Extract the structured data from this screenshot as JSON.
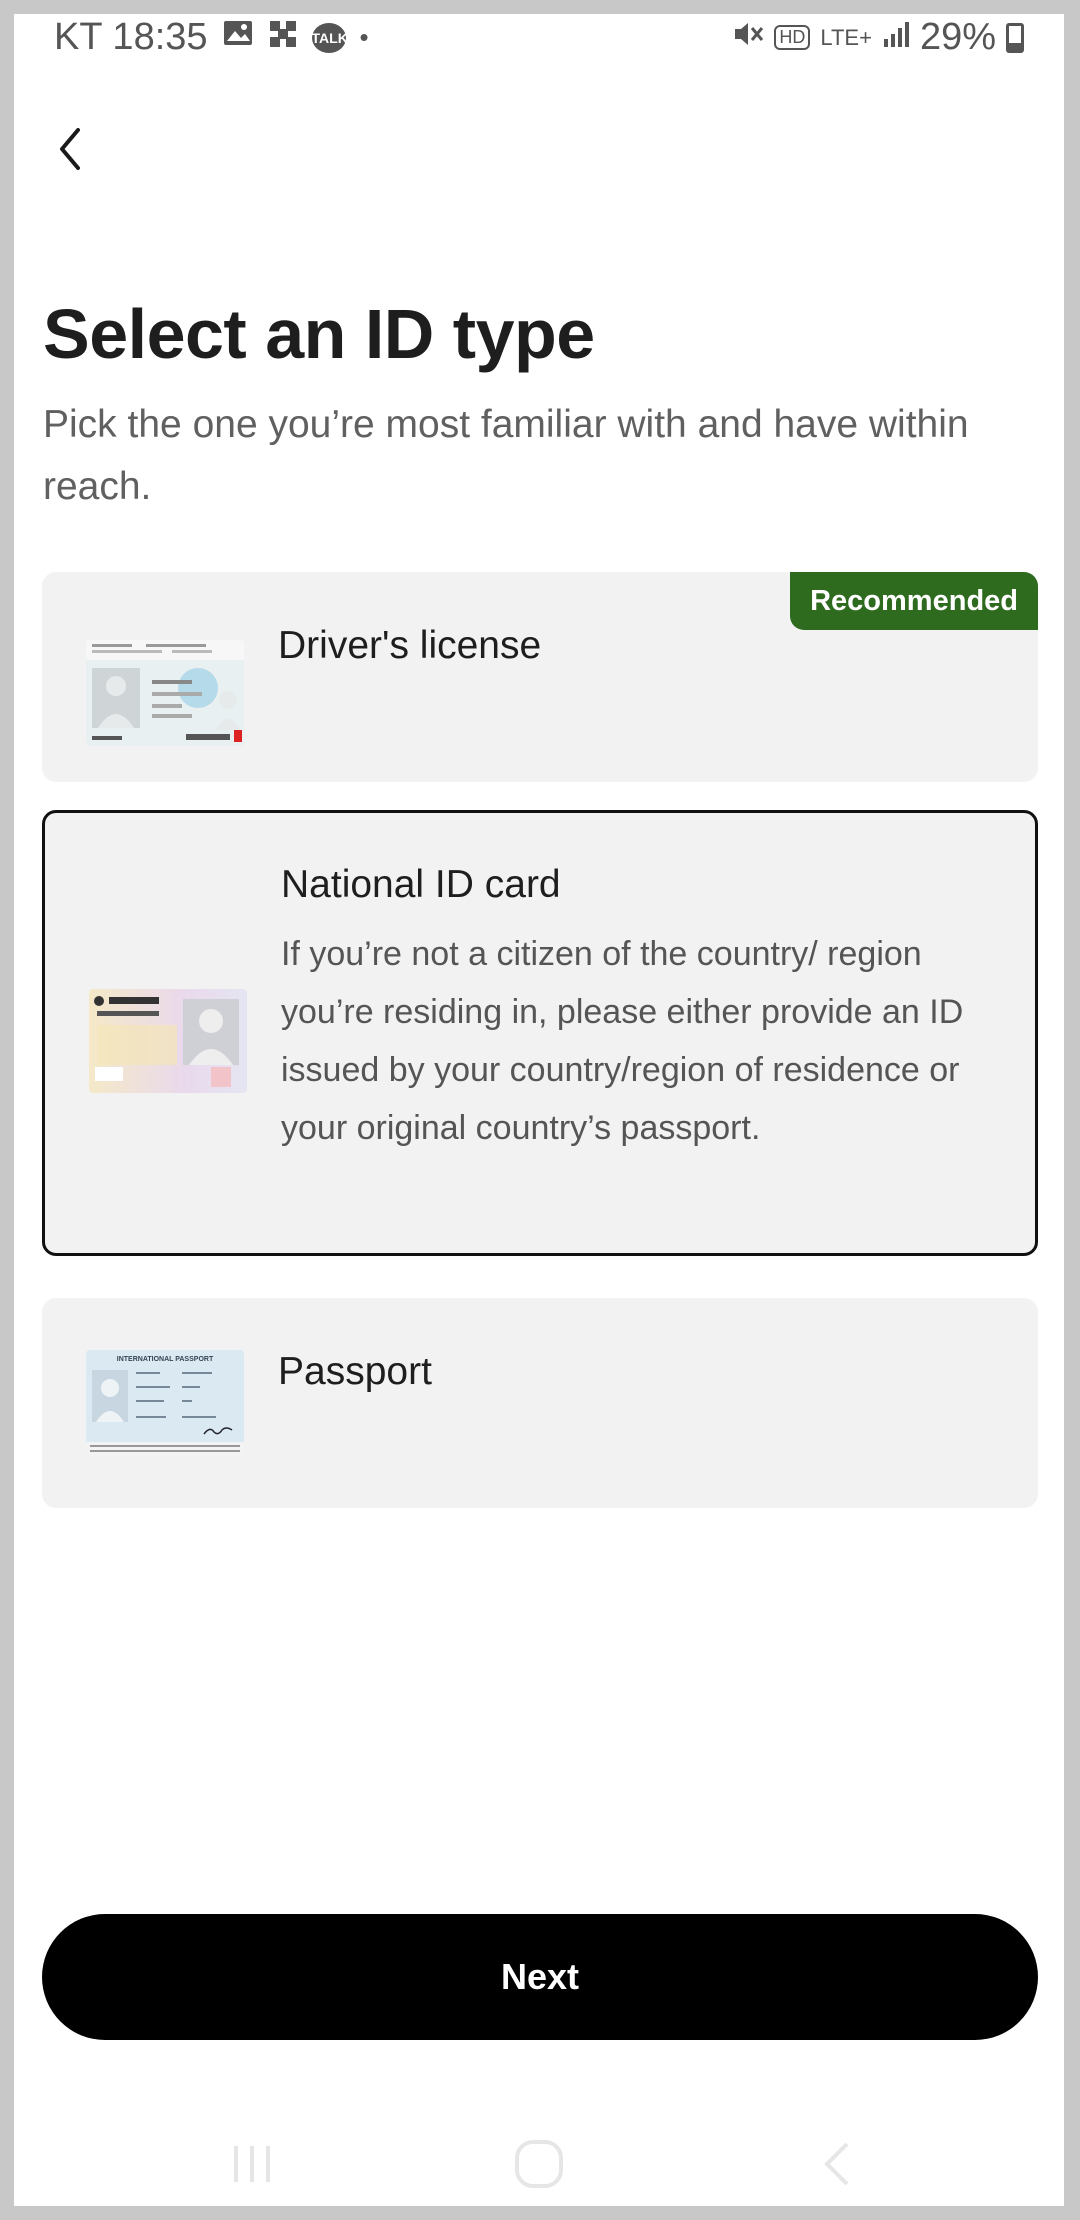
{
  "status_bar": {
    "carrier_time": "KT 18:35",
    "talk_label": "TALK",
    "dot": "•",
    "hd": "HD",
    "lte": "LTE+",
    "battery": "29%",
    "battery_level": 0.29
  },
  "header": {
    "back_icon": "chevron-left-icon"
  },
  "page": {
    "title": "Select an ID type",
    "subtitle": "Pick the one you’re most familiar with and have within reach."
  },
  "options": [
    {
      "label": "Driver's license",
      "badge": "Recommended",
      "selected": false
    },
    {
      "label": "National ID card",
      "description": "If you’re not a citizen of the country/ region you’re residing in, please either provide an ID issued by your country/region of residence or your original country’s passport.",
      "selected": true
    },
    {
      "label": "Passport",
      "thumb_text": "INTERNATIONAL PASSPORT",
      "selected": false
    }
  ],
  "actions": {
    "next_label": "Next"
  },
  "nav": {
    "recents_icon": "recents-icon",
    "home_icon": "home-icon",
    "back_icon": "back-icon"
  },
  "colors": {
    "badge": "#2e6b1f",
    "card_bg": "#f2f2f2",
    "primary_button": "#000000"
  }
}
